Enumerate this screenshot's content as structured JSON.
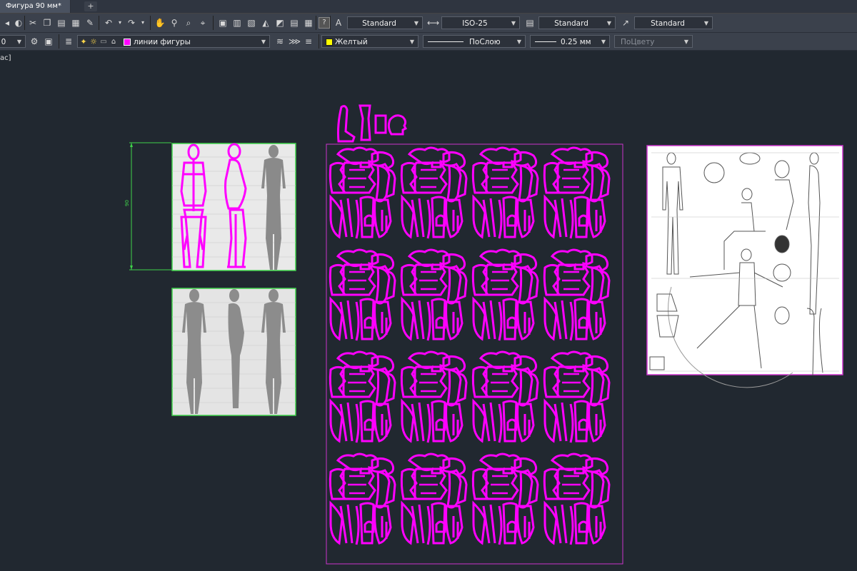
{
  "tabs": {
    "active_label": "Фигура 90 мм*",
    "new_tab": "+"
  },
  "toolbar1": {
    "text_style": "Standard",
    "dim_style": "ISO-25",
    "table_style": "Standard",
    "mleader_style": "Standard",
    "help_icon": "?"
  },
  "toolbar2": {
    "layer_name": "линии фигуры",
    "layer_color": "#ff00ff",
    "color_name": "Желтый",
    "color_swatch": "#ffff00",
    "linetype": "ПоСлою",
    "lineweight": "0.25 мм",
    "plotstyle": "ПоЦвету"
  },
  "command_line": "ас]",
  "drawing": {
    "dimension_value": "90",
    "figure_color": "#ff00ff",
    "frame_color": "#3fd24a",
    "sheet_border_color": "#cc33cc",
    "grid_rows": 4,
    "grid_cols": 4
  }
}
